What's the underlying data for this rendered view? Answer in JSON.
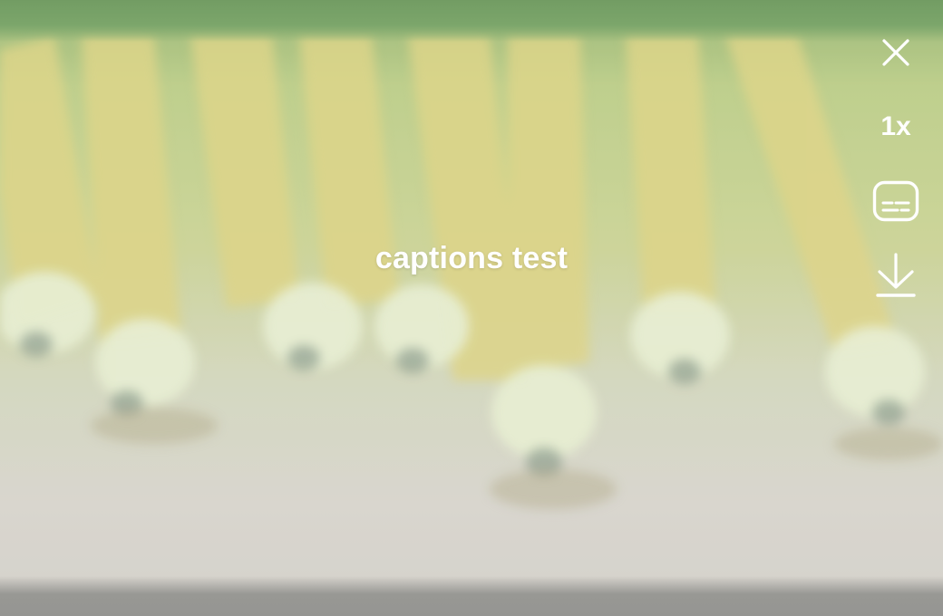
{
  "player": {
    "caption_text": "captions test",
    "playback_speed": "1x"
  },
  "controls": {
    "close_icon": "close-icon",
    "speed_label": "1x",
    "captions_icon": "subtitles-icon",
    "download_icon": "download-icon"
  },
  "theme": {
    "icon_color": "#ffffff",
    "top_band_color": "#5f8f4e",
    "bottom_band_color": "#8a8a86"
  }
}
